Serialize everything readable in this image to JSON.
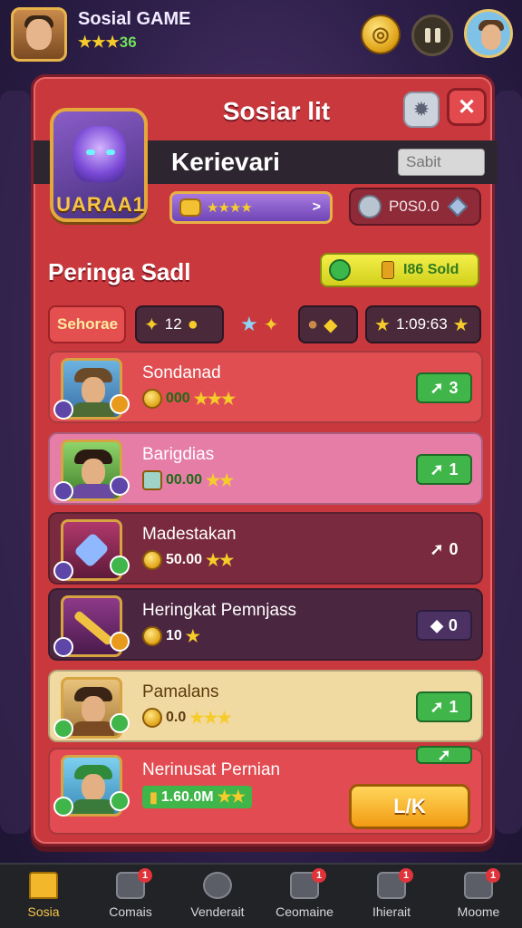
{
  "header": {
    "title": "Sosial GAME",
    "rating": "36",
    "rating_stars": "★★★"
  },
  "panel": {
    "title": "Sosiar lit",
    "subheader": "Kerievari",
    "search_placeholder": "Sabit",
    "badge_label": "UARAA1",
    "xp_stars": "★★★★",
    "position_text": "P0S0.0",
    "section_title": "Peringa Sadl",
    "reward_text": "I86 Sold",
    "filters": {
      "active": "Sehorae",
      "count": "12",
      "time": "1:09:63"
    },
    "players": [
      {
        "name": "Sondanad",
        "coins": "000",
        "stars": "★★★",
        "score": "3"
      },
      {
        "name": "Barigdias",
        "coins": "00.00",
        "stars": "★★",
        "score": "1"
      },
      {
        "name": "Madestakan",
        "coins": "50.00",
        "stars": "★★",
        "score": "0"
      },
      {
        "name": "Heringkat Pemnjass",
        "coins": "10",
        "stars": "★",
        "score": "0"
      },
      {
        "name": "Pamalans",
        "coins": "0.0",
        "stars": "★★★",
        "score": "1"
      },
      {
        "name": "Nerinusat Pernian",
        "coins": "1.60.0M",
        "stars": "★★",
        "score": ""
      }
    ],
    "ok_label": "L/K"
  },
  "bottom_nav": [
    {
      "label": "Sosia",
      "badge": ""
    },
    {
      "label": "Comais",
      "badge": "1"
    },
    {
      "label": "Venderait",
      "badge": ""
    },
    {
      "label": "Ceomaine",
      "badge": "1"
    },
    {
      "label": "Ihierait",
      "badge": "1"
    },
    {
      "label": "Moome",
      "badge": "1"
    }
  ],
  "colors": {
    "panel_red": "#c9383d",
    "accent_gold": "#f2b72a",
    "score_green": "#3fb54a"
  }
}
